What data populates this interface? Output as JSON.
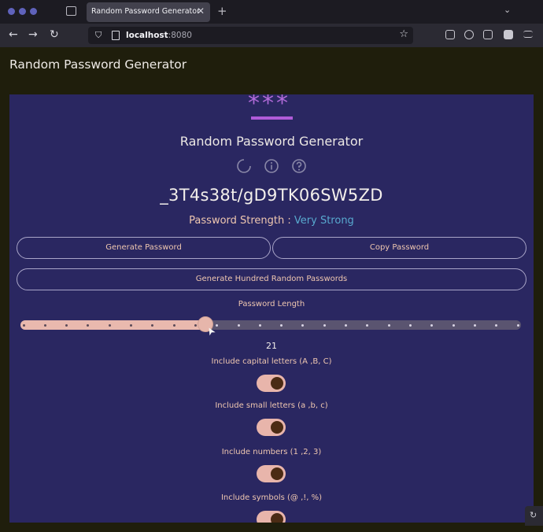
{
  "browser": {
    "tab_title": "Random Password Generator",
    "tab_close": "✕",
    "new_tab": "+",
    "tab_list": "⌄",
    "back": "←",
    "forward": "→",
    "reload": "↻",
    "url_host": "localhost",
    "url_port": ":8080",
    "bookmark_star": "☆"
  },
  "app": {
    "header_title": "Random Password Generator",
    "logo_stars": "***",
    "card_title": "Random Password Generator",
    "icons": [
      "refresh-icon",
      "info-icon",
      "help-icon"
    ],
    "password": "_3T4s38t/gD9TK06SW5ZD",
    "strength_label": "Password Strength : ",
    "strength_value": "Very Strong",
    "buttons": {
      "generate": "Generate Password",
      "copy": "Copy Password",
      "generate_hundred": "Generate Hundred Random Passwords"
    },
    "length": {
      "label": "Password Length",
      "value": 21,
      "value_text": "21",
      "min": 4,
      "max": 50
    },
    "options": [
      {
        "label": "Include capital letters (A ,B, C)",
        "checked": true
      },
      {
        "label": "Include small letters (a ,b, c)",
        "checked": true
      },
      {
        "label": "Include numbers (1 ,2, 3)",
        "checked": true
      },
      {
        "label": "Include symbols (@ ,!, %)",
        "checked": true
      }
    ]
  },
  "colors": {
    "card_bg": "#2a2761",
    "accent_purple": "#b06ad8",
    "strength_blue": "#58a9cf",
    "label_peach": "#efc7b0",
    "toggle_track": "#e8b5ab",
    "toggle_knob": "#4b2b14"
  }
}
